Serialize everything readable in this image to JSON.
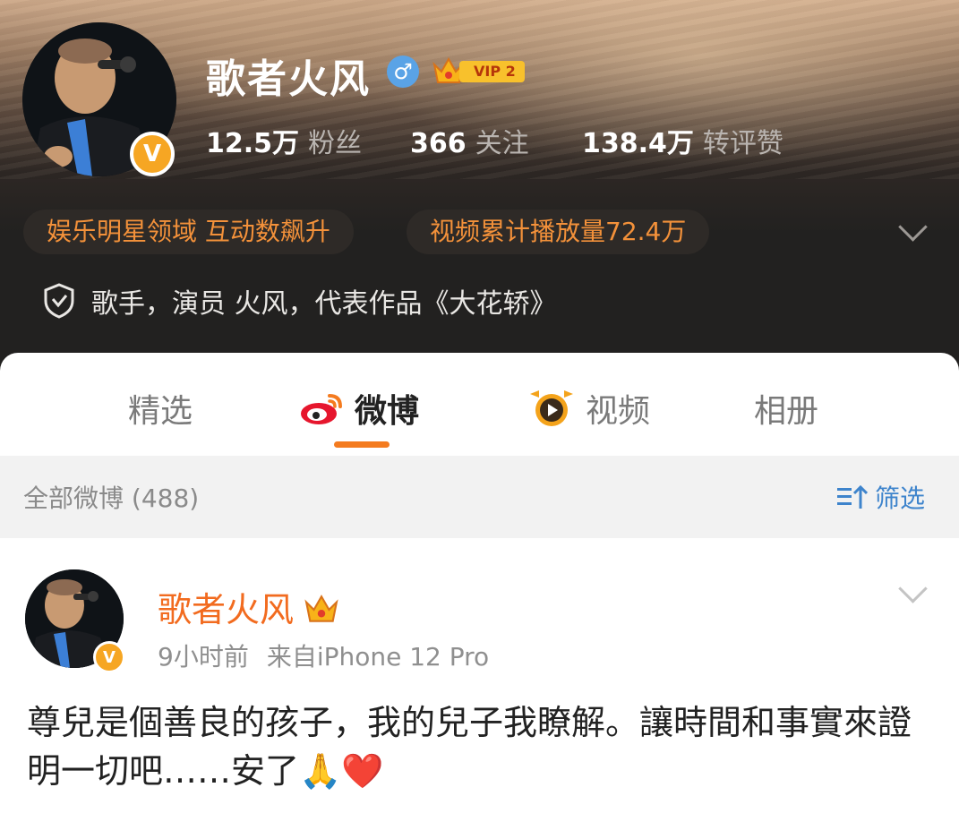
{
  "profile": {
    "name": "歌者火风",
    "gender_symbol": "♂",
    "vip_label": "VIP 2",
    "verified_badge": "V",
    "stats": {
      "fans_value": "12.5万",
      "fans_label": "粉丝",
      "follow_value": "366",
      "follow_label": "关注",
      "interact_value": "138.4万",
      "interact_label": "转评赞"
    },
    "tags": [
      "娱乐明星领域 互动数飙升",
      "视频累计播放量72.4万"
    ],
    "description": "歌手，演员 火风，代表作品《大花轿》"
  },
  "tabs": [
    {
      "label": "精选",
      "icon": null
    },
    {
      "label": "微博",
      "icon": "weibo-icon",
      "active": true
    },
    {
      "label": "视频",
      "icon": "video-play-icon"
    },
    {
      "label": "相册",
      "icon": null
    }
  ],
  "filter_bar": {
    "all_label": "全部微博 (488)",
    "filter_label": "筛选",
    "filter_icon_text": "三↑"
  },
  "post": {
    "author": "歌者火风",
    "time": "9小时前",
    "source": "来自iPhone 12 Pro",
    "text": "尊兒是個善良的孩子，我的兒子我瞭解。讓時間和事實來證明一切吧……安了🙏❤️"
  },
  "colors": {
    "accent_orange": "#f47b1f",
    "name_orange": "#f26b1f",
    "link_blue": "#3e84cc",
    "verified_gold": "#f6a623"
  }
}
